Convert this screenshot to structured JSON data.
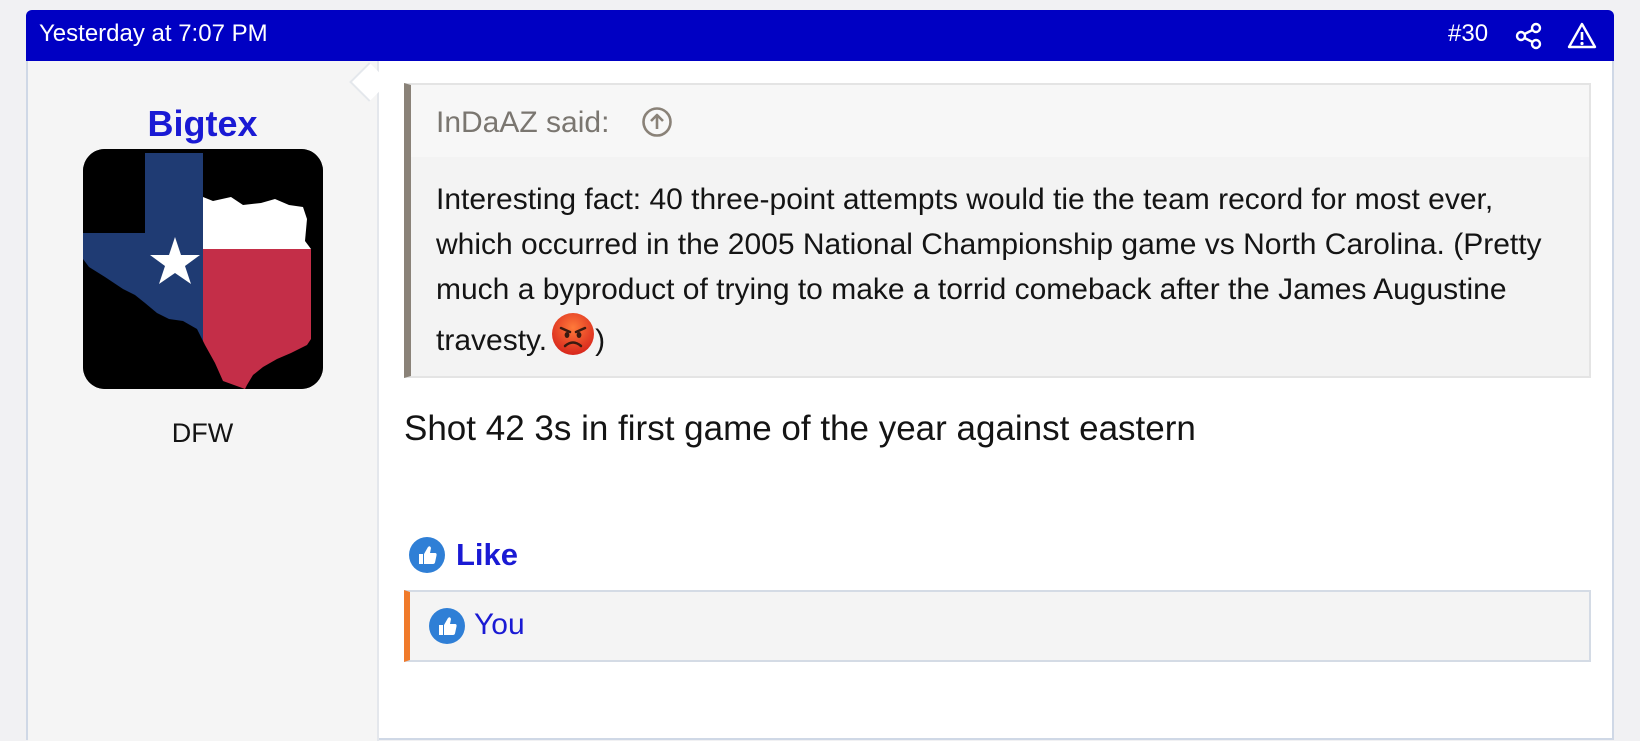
{
  "post": {
    "date": "Yesterday at 7:07 PM",
    "number": "#30",
    "header_color": "#0000c3",
    "icons": {
      "share": "share-icon",
      "report": "warning-triangle-icon"
    }
  },
  "user": {
    "name": "Bigtex",
    "location": "DFW",
    "avatar": "texas-flag-map-avatar"
  },
  "quote": {
    "author": "InDaAZ said:",
    "jump_icon": "arrow-up-circle-icon",
    "text": "Interesting fact: 40 three-point attempts would tie the team record for most ever, which occurred in the 2005 National Championship game vs North Carolina. (Pretty much a byproduct of trying to make a torrid comeback after the James Augustine travesty.",
    "text_end": ")",
    "emoji": "angry-face-emoji"
  },
  "message": {
    "text": "Shot 42 3s in first game of the year against eastern"
  },
  "actions": {
    "like_label": "Like",
    "like_icon": "thumbs-up-icon"
  },
  "reactions": {
    "text": "You",
    "accent_color": "#f07a2a"
  }
}
